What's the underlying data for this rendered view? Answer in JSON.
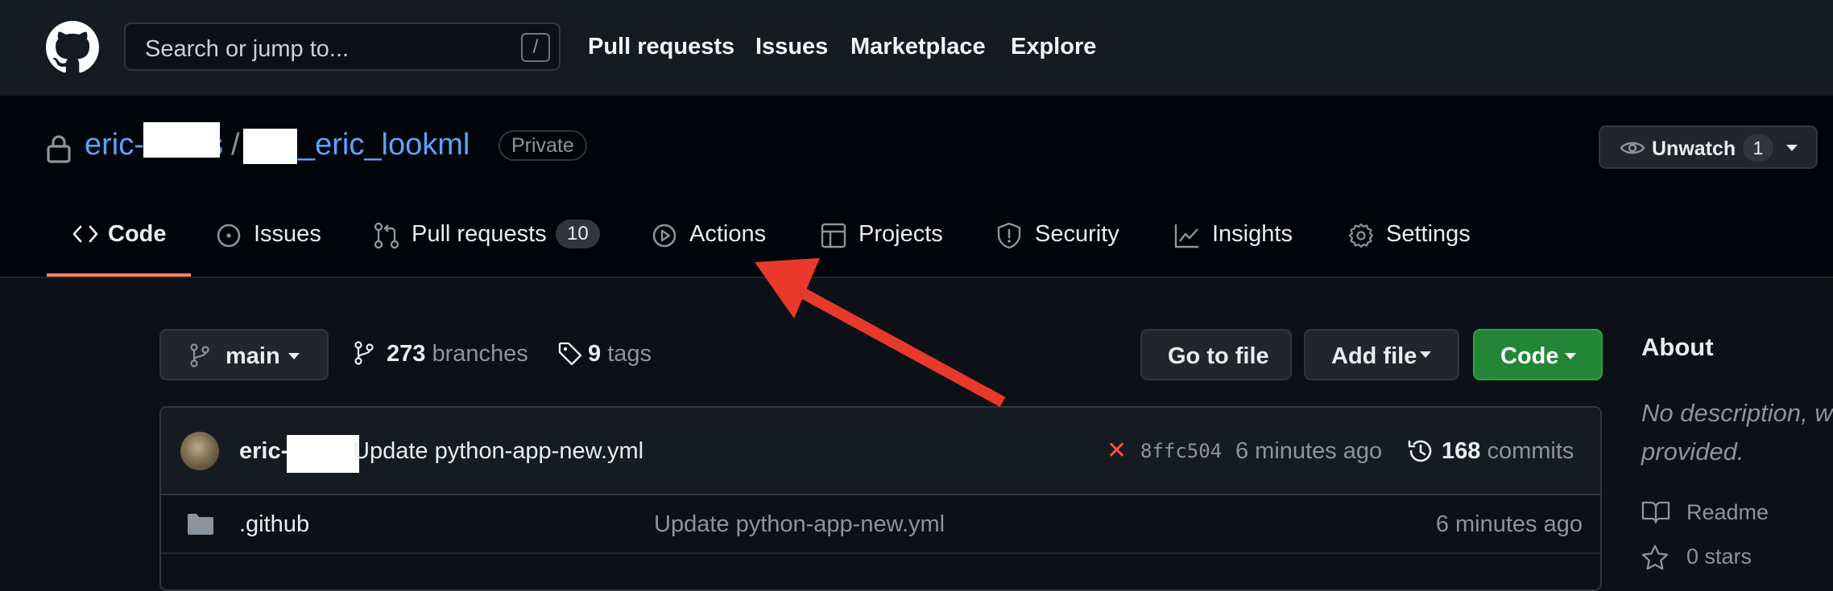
{
  "header": {
    "search_placeholder": "Search or jump to...",
    "search_shortcut": "/",
    "nav": [
      "Pull requests",
      "Issues",
      "Marketplace",
      "Explore"
    ]
  },
  "repo": {
    "owner": "eric-",
    "owner_suffix": "s",
    "separator": "/",
    "name": "_eric_lookml",
    "visibility": "Private",
    "watch": {
      "label": "Unwatch",
      "count": "1"
    }
  },
  "tabs": [
    {
      "label": "Code",
      "icon": "code-icon",
      "active": true
    },
    {
      "label": "Issues",
      "icon": "issue-opened-icon"
    },
    {
      "label": "Pull requests",
      "icon": "git-pull-request-icon",
      "count": "10"
    },
    {
      "label": "Actions",
      "icon": "play-icon"
    },
    {
      "label": "Projects",
      "icon": "table-icon"
    },
    {
      "label": "Security",
      "icon": "shield-icon"
    },
    {
      "label": "Insights",
      "icon": "graph-icon"
    },
    {
      "label": "Settings",
      "icon": "gear-icon"
    }
  ],
  "toolbar": {
    "branch": "main",
    "branches_count": "273",
    "branches_label": "branches",
    "tags_count": "9",
    "tags_label": "tags",
    "go_to_file": "Go to file",
    "add_file": "Add file",
    "code": "Code"
  },
  "latest_commit": {
    "author": "eric-",
    "message": "Update python-app-new.yml",
    "status": "✕",
    "sha": "8ffc504",
    "time": "6 minutes ago",
    "commits_count": "168",
    "commits_label": "commits"
  },
  "files": [
    {
      "name": ".github",
      "message": "Update python-app-new.yml",
      "time": "6 minutes ago",
      "type": "folder"
    }
  ],
  "about": {
    "heading": "About",
    "description": "No description, w provided.",
    "readme": "Readme",
    "stars": "0 stars"
  },
  "annotation": {
    "color": "#e8392a"
  }
}
